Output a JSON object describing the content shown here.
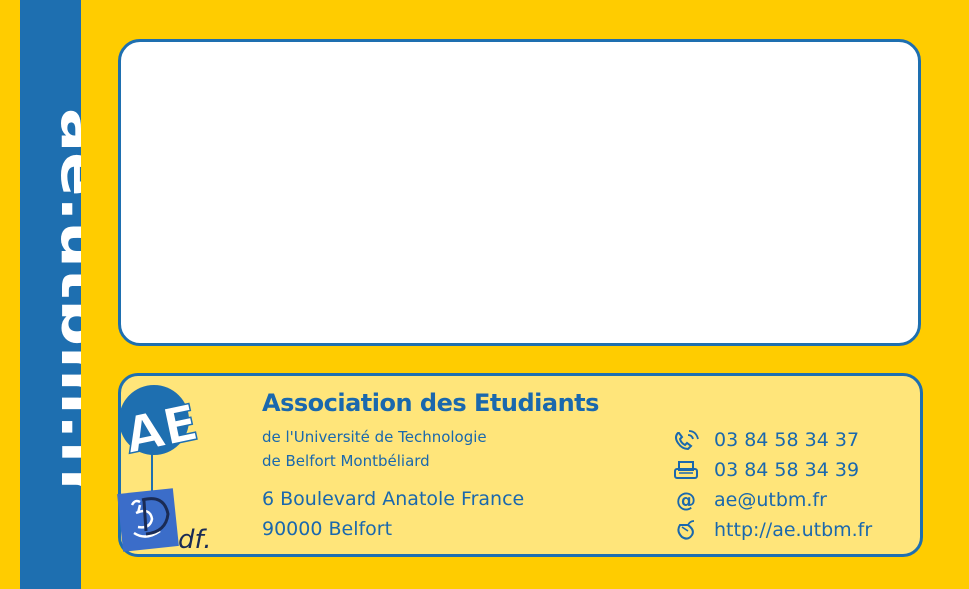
{
  "side_url": "ae.utbm.fr",
  "logos": {
    "ae_text": "AE",
    "bdf_text": "df."
  },
  "organization": {
    "name": "Association des Etudiants",
    "subtitle_line1": "de l'Université de Technologie",
    "subtitle_line2": "de Belfort Montbéliard"
  },
  "address": {
    "street": "6 Boulevard Anatole France",
    "city": "90000 Belfort"
  },
  "contacts": [
    {
      "icon": "phone-icon",
      "value": "03 84 58 34 37"
    },
    {
      "icon": "fax-icon",
      "value": "03 84 58 34 39"
    },
    {
      "icon": "at-sign-icon",
      "value": "ae@utbm.fr"
    },
    {
      "icon": "mouse-icon",
      "value": "http://ae.utbm.fr"
    }
  ],
  "colors": {
    "background": "#ffcc00",
    "brand_blue": "#1e6fb0",
    "panel_light_yellow": "#ffe57a",
    "panel_white": "#ffffff"
  }
}
